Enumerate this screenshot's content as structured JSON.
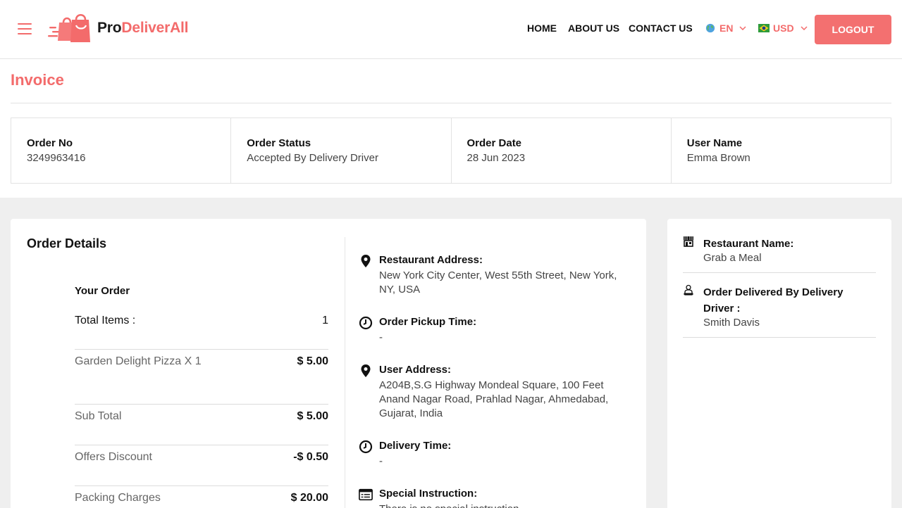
{
  "brand": {
    "name_part1": "Pro",
    "name_part2": "DeliverAll",
    "accent": "#f36b6b"
  },
  "nav": {
    "home": "HOME",
    "about": "ABOUT US",
    "contact": "CONTACT US",
    "language": "EN",
    "currency": "USD",
    "logout": "LOGOUT"
  },
  "page": {
    "title": "Invoice"
  },
  "summary": [
    {
      "label": "Order No",
      "value": "3249963416"
    },
    {
      "label": "Order Status",
      "value": "Accepted By Delivery Driver"
    },
    {
      "label": "Order Date",
      "value": "28 Jun 2023"
    },
    {
      "label": "User Name",
      "value": "Emma Brown"
    }
  ],
  "order_details": {
    "title": "Order Details",
    "your_order": "Your Order",
    "total_items_label": "Total Items :",
    "total_items_value": "1",
    "item_name": "Garden Delight Pizza X 1",
    "item_price": "$ 5.00",
    "sub_total_label": "Sub Total",
    "sub_total_value": "$ 5.00",
    "discount_label": "Offers Discount",
    "discount_value": "-$ 0.50",
    "packing_label": "Packing Charges",
    "packing_value": "$ 20.00"
  },
  "info": {
    "restaurant_address_label": "Restaurant Address:",
    "restaurant_address_value": "New York City Center, West 55th Street, New York, NY, USA",
    "pickup_label": "Order Pickup Time:",
    "pickup_value": "-",
    "user_address_label": "User Address:",
    "user_address_value": "A204B,S.G Highway Mondeal Square, 100 Feet Anand Nagar Road, Prahlad Nagar, Ahmedabad, Gujarat, India",
    "delivery_label": "Delivery Time:",
    "delivery_value": "-",
    "instruction_label": "Special Instruction:",
    "instruction_value": "There is no special instruction"
  },
  "side": {
    "restaurant_label": "Restaurant Name:",
    "restaurant_value": "Grab a Meal",
    "driver_label": "Order Delivered By Delivery Driver :",
    "driver_value": "Smith Davis"
  }
}
